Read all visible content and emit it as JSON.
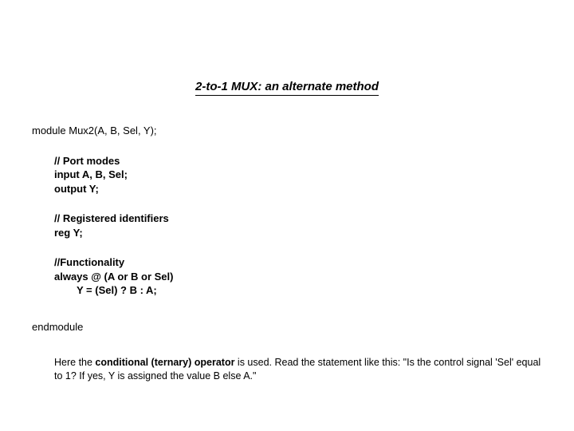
{
  "title": "2-to-1 MUX: an alternate method",
  "code": {
    "moduleDecl": "module Mux2(A, B, Sel, Y);",
    "portComment": "// Port modes",
    "portInput": "input A, B, Sel;",
    "portOutput": "output Y;",
    "regComment": "// Registered identifiers",
    "regDecl": "reg Y;",
    "funcComment": "//Functionality",
    "alwaysLine": "always @ (A or B or Sel)",
    "assignLine": "Y = (Sel) ? B : A;",
    "endmodule": "endmodule"
  },
  "desc": {
    "pre": "Here the ",
    "bold": "conditional (ternary) operator",
    "post": " is used. Read the statement like this: \"Is the control signal 'Sel' equal to 1? If yes, Y is assigned the value B else A.\""
  }
}
